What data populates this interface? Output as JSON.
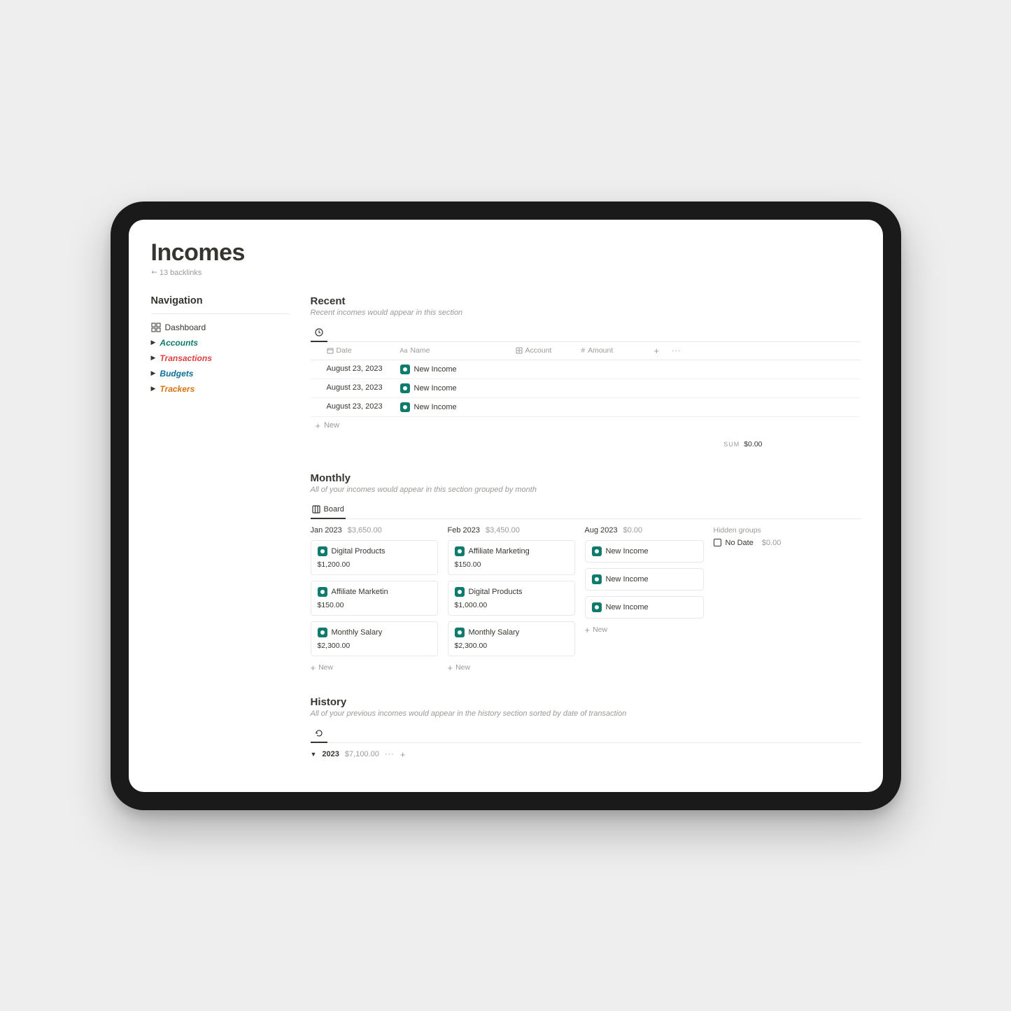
{
  "page": {
    "title": "Incomes",
    "backlinks_text": "13 backlinks"
  },
  "navigation": {
    "heading": "Navigation",
    "items": [
      {
        "label": "Dashboard"
      },
      {
        "label": "Accounts"
      },
      {
        "label": "Transactions"
      },
      {
        "label": "Budgets"
      },
      {
        "label": "Trackers"
      }
    ]
  },
  "recent": {
    "heading": "Recent",
    "sub": "Recent incomes would appear in this section",
    "columns": {
      "date": "Date",
      "name": "Name",
      "account": "Account",
      "amount": "Amount"
    },
    "rows": [
      {
        "date": "August 23, 2023",
        "name": "New Income"
      },
      {
        "date": "August 23, 2023",
        "name": "New Income"
      },
      {
        "date": "August 23, 2023",
        "name": "New Income"
      }
    ],
    "new_label": "New",
    "sum_label": "SUM",
    "sum_value": "$0.00"
  },
  "monthly": {
    "heading": "Monthly",
    "sub": "All of your incomes would appear in this section grouped by month",
    "tab_label": "Board",
    "hidden_groups_label": "Hidden groups",
    "no_date_label": "No Date",
    "no_date_amount": "$0.00",
    "new_label": "New",
    "columns": [
      {
        "month": "Jan 2023",
        "amount": "$3,650.00",
        "cards": [
          {
            "title": "Digital Products",
            "sub": "$1,200.00"
          },
          {
            "title": "Affiliate Marketin",
            "sub": "$150.00"
          },
          {
            "title": "Monthly Salary",
            "sub": "$2,300.00"
          }
        ]
      },
      {
        "month": "Feb 2023",
        "amount": "$3,450.00",
        "cards": [
          {
            "title": "Affiliate Marketing",
            "sub": "$150.00"
          },
          {
            "title": "Digital Products",
            "sub": "$1,000.00"
          },
          {
            "title": "Monthly Salary",
            "sub": "$2,300.00"
          }
        ]
      },
      {
        "month": "Aug 2023",
        "amount": "$0.00",
        "cards": [
          {
            "title": "New Income"
          },
          {
            "title": "New Income"
          },
          {
            "title": "New Income"
          }
        ]
      }
    ]
  },
  "history": {
    "heading": "History",
    "sub": "All of your previous incomes would appear in the history section sorted by date of transaction",
    "year": "2023",
    "year_amount": "$7,100.00"
  }
}
